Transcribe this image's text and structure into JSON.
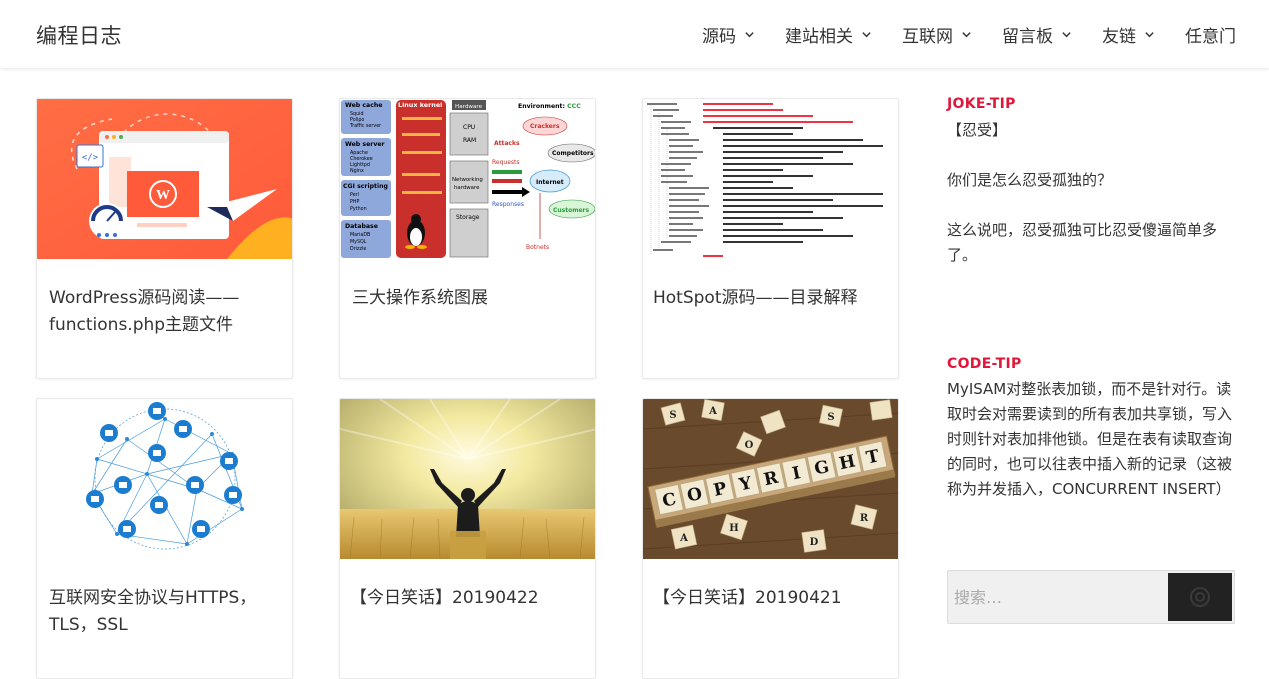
{
  "site": {
    "title": "编程日志"
  },
  "nav": {
    "items": [
      {
        "label": "源码",
        "has_dropdown": true
      },
      {
        "label": "建站相关",
        "has_dropdown": true
      },
      {
        "label": "互联网",
        "has_dropdown": true
      },
      {
        "label": "留言板",
        "has_dropdown": true
      },
      {
        "label": "友链",
        "has_dropdown": true
      },
      {
        "label": "任意门",
        "has_dropdown": false
      }
    ]
  },
  "posts": [
    {
      "title": " WordPress源码阅读——functions.php主题文件"
    },
    {
      "title": "三大操作系统图展"
    },
    {
      "title": "HotSpot源码——目录解释"
    },
    {
      "title": " 互联网安全协议与HTTPS，TLS，SSL"
    },
    {
      "title": "【今日笑话】20190422"
    },
    {
      "title": "【今日笑话】20190421"
    }
  ],
  "thumbs": {
    "os": {
      "col1": [
        "Web cache",
        "Squid",
        "Polipo",
        "Traffic server",
        "Web server",
        "Apache",
        "Cherokee",
        "Lighttpd",
        "Nginx",
        "CGI scripting",
        "Perl",
        "PHP",
        "Python",
        "Database",
        "MariaDB",
        "MySQL",
        "Drizzle"
      ],
      "kernel": "Linux kernel",
      "hardware": "Hardware",
      "env": "Environment: CCC",
      "cpu": "CPU",
      "ram": "RAM",
      "net": "Networking hardware",
      "storage": "Storage",
      "attacks": "Attacks",
      "requests": "Requests",
      "responses": "Responses",
      "internet": "Internet",
      "crackers": "Crackers",
      "competitors": "Competitors",
      "customers": "Customers",
      "botnets": "Botnets"
    },
    "scrabble": {
      "word": [
        "C",
        "O",
        "P",
        "Y",
        "R",
        "I",
        "G",
        "H",
        "T"
      ]
    }
  },
  "sidebar": {
    "joke": {
      "heading": "JOKE-TIP",
      "text": "【忍受】\n\n你们是怎么忍受孤独的？\n\n这么说吧，忍受孤独可比忍受傻逼简单多了。"
    },
    "code": {
      "heading": "CODE-TIP",
      "text": "MyISAM对整张表加锁，而不是针对行。读取时会对需要读到的所有表加共享锁，写入时则针对表加排他锁。但是在表有读取查询的同时，也可以往表中插入新的记录（这被称为并发插入，CONCURRENT INSERT）"
    }
  },
  "search": {
    "placeholder": "搜索…"
  },
  "colors": {
    "accent": "#e0173a",
    "wp_orange": "#ff6a3d"
  }
}
